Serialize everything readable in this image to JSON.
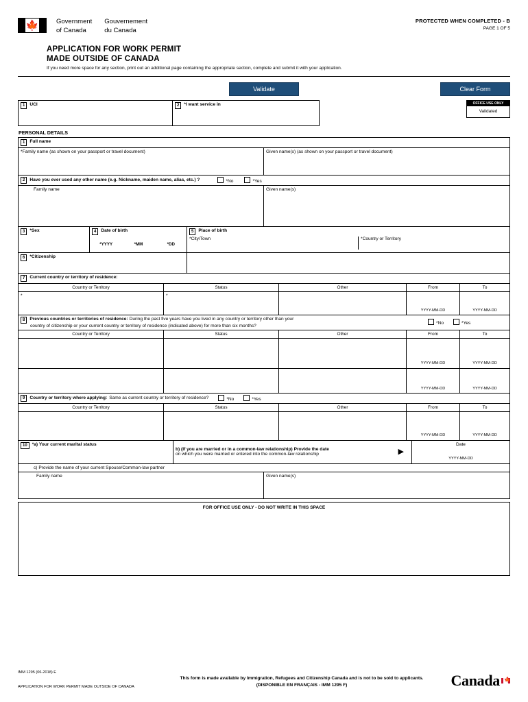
{
  "header": {
    "wordmark_en_l1": "Government",
    "wordmark_en_l2": "of Canada",
    "wordmark_fr_l1": "Gouvernement",
    "wordmark_fr_l2": "du Canada",
    "protected": "PROTECTED WHEN COMPLETED - B",
    "page": "PAGE 1 OF 5",
    "flag_icon": "canada-flag-icon"
  },
  "title": {
    "line1": "APPLICATION FOR WORK PERMIT",
    "line2": "MADE OUTSIDE OF CANADA",
    "note": "If you need more space for any section, print out an additional page containing the appropriate section, complete and submit it with your application."
  },
  "buttons": {
    "validate": "Validate",
    "clear": "Clear Form",
    "accent": "#1f4e79"
  },
  "top": {
    "uci_num": "1",
    "uci_label": "UCI",
    "service_num": "2",
    "service_label": "*I want service in",
    "office_title": "OFFICE USE ONLY",
    "office_value": "Validated"
  },
  "section": {
    "personal_details": "PERSONAL DETAILS"
  },
  "q1": {
    "num": "1",
    "title": "Full name",
    "family": "*Family name (as shown on your passport or travel document)",
    "given": "Given name(s) (as shown on your passport or travel document)"
  },
  "q2": {
    "num": "2",
    "title": "Have you ever used any other name (e.g. Nickname, maiden name, alias, etc.) ?",
    "no": "*No",
    "yes": "*Yes",
    "family": "Family name",
    "given": "Given name(s)"
  },
  "q3": {
    "num": "3",
    "title": "*Sex"
  },
  "q4": {
    "num": "4",
    "title": "Date of birth",
    "yyyy": "*YYYY",
    "mm": "*MM",
    "dd": "*DD"
  },
  "q5": {
    "num": "5",
    "title": "Place of birth",
    "city": "*City/Town",
    "country": "*Country or Territory"
  },
  "q6": {
    "num": "6",
    "title": "*Citizenship"
  },
  "q7": {
    "num": "7",
    "title": "Current country or territory of residence:",
    "headers": [
      "Country or Territory",
      "Status",
      "Other",
      "From",
      "To"
    ],
    "star1": "*",
    "star2": "*",
    "from_fmt": "YYYY-MM-DD",
    "to_fmt": "YYYY-MM-DD"
  },
  "q8": {
    "num": "8",
    "title": "Previous countries or territories of residence:",
    "text1": "During the past five years have you lived in any country or territory other than your",
    "text2": "country of citizenship or your current country or territory of residence (indicated above) for more than six months?",
    "no": "*No",
    "yes": "*Yes",
    "headers": [
      "Country or Territory",
      "Status",
      "Other",
      "From",
      "To"
    ],
    "from_fmt": "YYYY-MM-DD",
    "to_fmt": "YYYY-MM-DD"
  },
  "q9": {
    "num": "9",
    "title": "Country or territory where applying:",
    "text": "Same as current country or territory of residence?",
    "no": "*No",
    "yes": "*Yes",
    "headers": [
      "Country or Territory",
      "Status",
      "Other",
      "From",
      "To"
    ],
    "from_fmt": "YYYY-MM-DD",
    "to_fmt": "YYYY-MM-DD"
  },
  "q10": {
    "num": "10",
    "a": "*a) Your current marital status",
    "b1": "b) (If you are married or in a common-law relationship) Provide the date",
    "b2": "on which you were married or entered into the common-law relationship",
    "date_label": "Date",
    "date_fmt": "YYYY-MM-DD",
    "c": "c) Provide the name of your current Spouse/Common-law partner",
    "family": "Family name",
    "given": "Given name(s)",
    "arrow_icon": "right-arrow-icon"
  },
  "office_space": {
    "caption": "FOR OFFICE USE ONLY - DO NOT WRITE IN THIS SPACE"
  },
  "footer": {
    "left1": "IMM 1295 (06-2018) E",
    "left2": "APPLICATION FOR WORK PERMIT MADE OUTSIDE OF CANADA",
    "center1": "This form is made available by Immigration, Refugees and Citizenship Canada and is not to be sold to applicants.",
    "center2": "(DISPONIBLE EN FRANÇAIS - IMM 1295 F)",
    "canada": "Canada"
  }
}
